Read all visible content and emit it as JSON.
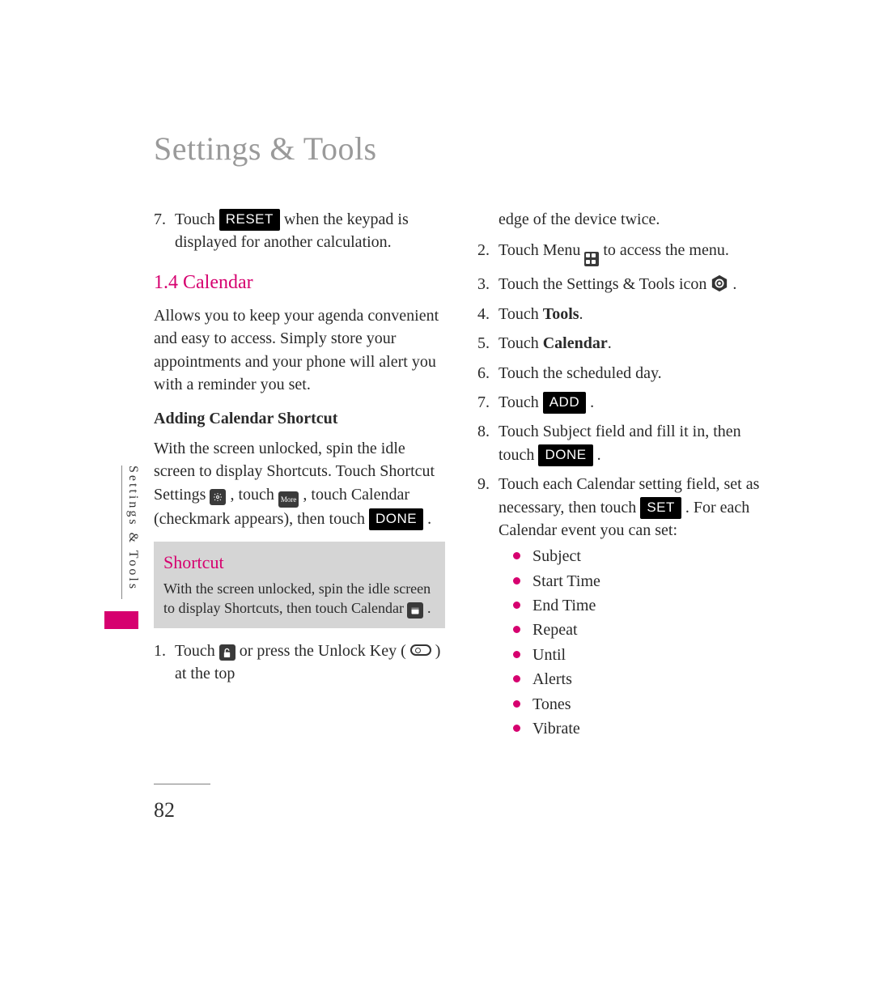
{
  "title": "Settings & Tools",
  "side_tab": "Settings & Tools",
  "page_number": "82",
  "left": {
    "step7_pre": "Touch ",
    "step7_btn": "RESET",
    "step7_post": " when the keypad is displayed for another calculation.",
    "section_heading": "1.4 Calendar",
    "intro": "Allows you to keep your agenda convenient and easy to access. Simply store your appointments and your phone will alert you with a reminder you set.",
    "sub_heading": "Adding Calendar Shortcut",
    "add_shortcut_a": "With the screen unlocked, spin the idle screen to display Shortcuts. Touch Shortcut Settings ",
    "add_shortcut_b": ", touch ",
    "add_shortcut_more": "More",
    "add_shortcut_c": ", touch Calendar (checkmark appears), then touch ",
    "add_shortcut_done": "DONE",
    "add_shortcut_d": ".",
    "shortcut_title": "Shortcut",
    "shortcut_body_a": "With the screen unlocked, spin the idle screen to display Shortcuts, then touch Calendar ",
    "shortcut_body_b": ".",
    "bottom_step1_a": "Touch ",
    "bottom_step1_b": " or press the Unlock Key ( ",
    "bottom_step1_c": " ) at the top"
  },
  "right": {
    "cont": "edge of the device twice.",
    "s2_a": "Touch Menu ",
    "s2_b": " to access the menu.",
    "s3_a": "Touch the Settings & Tools icon ",
    "s3_b": ".",
    "s4_a": "Touch ",
    "s4_bold": "Tools",
    "s4_b": ".",
    "s5_a": "Touch ",
    "s5_bold": "Calendar",
    "s5_b": ".",
    "s6": "Touch the scheduled day.",
    "s7_a": "Touch ",
    "s7_btn": "ADD",
    "s7_b": ".",
    "s8_a": "Touch Subject field and fill it in, then touch ",
    "s8_btn": "DONE",
    "s8_b": ".",
    "s9_a": "Touch each Calendar setting field, set as necessary, then touch ",
    "s9_btn": "SET",
    "s9_b": ". For each Calendar event you can set:",
    "bullets": [
      "Subject",
      "Start Time",
      "End Time",
      "Repeat",
      "Until",
      "Alerts",
      "Tones",
      "Vibrate"
    ]
  },
  "nums": {
    "n7": "7.",
    "n1": "1.",
    "n2": "2.",
    "n3": "3.",
    "n4": "4.",
    "n5": "5.",
    "n6": "6.",
    "n8": "8.",
    "n9": "9."
  }
}
